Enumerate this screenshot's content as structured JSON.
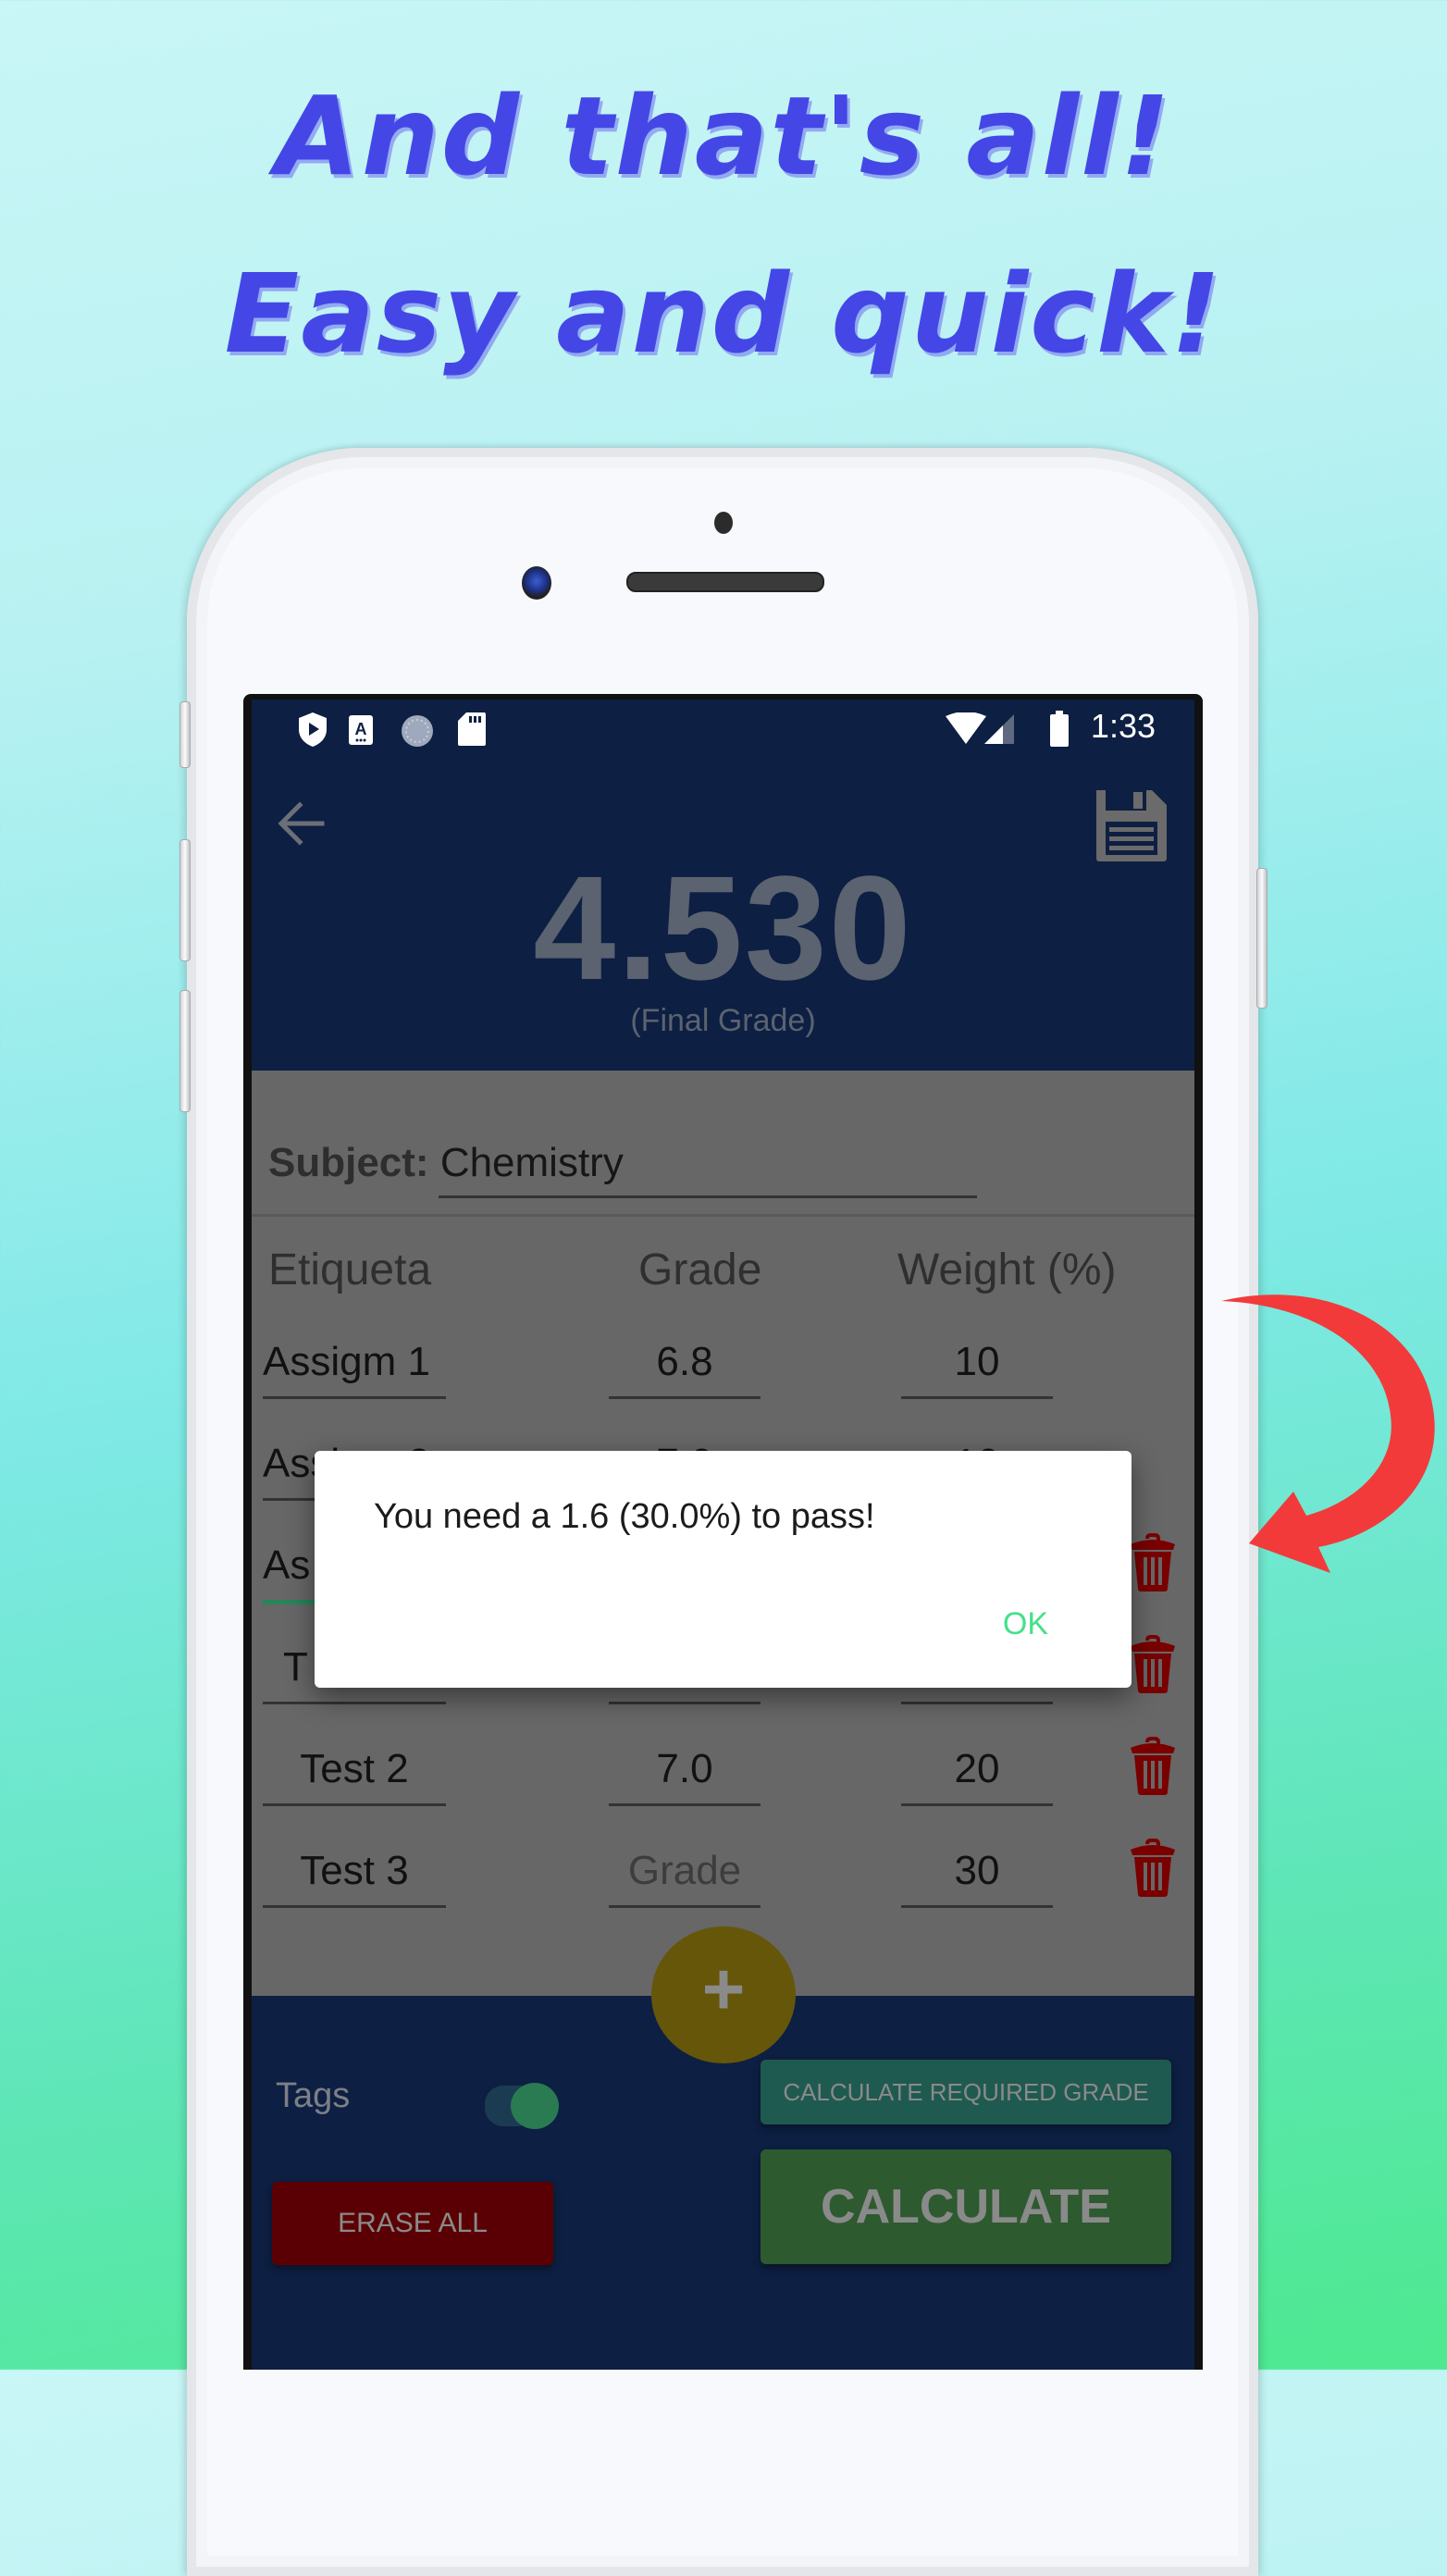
{
  "promo": {
    "headline_line1": "And that's all!",
    "headline_line2": "Easy and quick!"
  },
  "status_bar": {
    "left_icons": [
      "play-protect-icon",
      "keyboard-a-icon",
      "sync-circle-icon",
      "sd-card-icon"
    ],
    "right_icons": [
      "wifi-icon",
      "cell-signal-icon",
      "battery-icon"
    ],
    "time": "1:33"
  },
  "app_bar": {
    "back_icon": "arrow-left-icon",
    "save_icon": "floppy-save-icon",
    "final_grade_value": "4.530",
    "final_grade_caption": "(Final Grade)"
  },
  "subject": {
    "label": "Subject:",
    "value": "Chemistry"
  },
  "table": {
    "headers": [
      "Etiqueta",
      "Grade",
      "Weight (%)"
    ],
    "rows": [
      {
        "tag": "Assigm 1",
        "grade": "6.8",
        "weight": "10",
        "grade_is_placeholder": false
      },
      {
        "tag": "Assigm 2",
        "grade": "7.0",
        "weight": "10",
        "grade_is_placeholder": false
      },
      {
        "tag": "As",
        "grade": "",
        "weight": "",
        "grade_is_placeholder": false
      },
      {
        "tag": "T",
        "grade": "",
        "weight": "",
        "grade_is_placeholder": false
      },
      {
        "tag": "Test 2",
        "grade": "7.0",
        "weight": "20",
        "grade_is_placeholder": false
      },
      {
        "tag": "Test 3",
        "grade": "Grade",
        "weight": "30",
        "grade_is_placeholder": true
      }
    ]
  },
  "fab": {
    "label": "+"
  },
  "bottom_bar": {
    "tags_label": "Tags",
    "tags_toggle_on": true,
    "calc_required_label": "CALCULATE REQUIRED GRADE",
    "calculate_label": "CALCULATE",
    "erase_all_label": "ERASE ALL"
  },
  "dialog": {
    "message": "You need a 1.6 (30.0%) to pass!",
    "ok_label": "OK"
  },
  "colors": {
    "navy": "#0d1f42",
    "accent_green": "#44e08a",
    "headline_blue": "#4447e6",
    "arrow_red": "#f23a3a",
    "trash_red": "#7a0000"
  }
}
